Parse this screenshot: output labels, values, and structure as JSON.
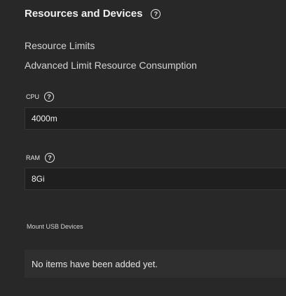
{
  "section": {
    "title": "Resources and Devices",
    "help_icon": "question-circle-icon"
  },
  "subsections": {
    "resource_limits": "Resource Limits",
    "advanced": "Advanced Limit Resource Consumption"
  },
  "cpu": {
    "label": "CPU",
    "help_icon": "question-circle-icon",
    "value": "4000m"
  },
  "ram": {
    "label": "RAM",
    "help_icon": "question-circle-icon",
    "value": "8Gi"
  },
  "usb": {
    "label": "Mount USB Devices",
    "empty_text": "No items have been added yet."
  },
  "colors": {
    "background": "#282828",
    "input_background": "#1f1f1f",
    "list_background": "#2f2f2f",
    "text": "#e6e6e6"
  }
}
